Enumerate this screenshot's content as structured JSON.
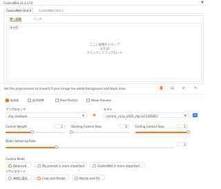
{
  "header": {
    "title": "ControlNet v1.1.174",
    "collapse_icon": "triangle-down-icon"
  },
  "tabs": [
    {
      "label": "ControlNet Unit 0",
      "active": true
    },
    {
      "label": "ControlNet Unit 1",
      "active": false
    }
  ],
  "image_panel": {
    "subtabs": [
      {
        "label": "単一画像",
        "active": true
      },
      {
        "label": "バッチ",
        "active": false
      }
    ],
    "image_label": "画像",
    "drop_text": [
      "ここに画像をドロップ",
      "-または-",
      "クリックしてアップロード"
    ]
  },
  "note": "Set the preprocessor to [invert] If your image has white background and black lines.",
  "toolbar_icons": [
    "camera-icon",
    "clipboard-icon",
    "swap-icon",
    "pencil-icon"
  ],
  "checkboxes": [
    {
      "label": "有効化",
      "checked": true
    },
    {
      "label": "低VRAM",
      "checked": false
    },
    {
      "label": "Pixel Perfect",
      "checked": false
    },
    {
      "label": "Allow Preview",
      "checked": false
    }
  ],
  "preprocessor": {
    "label": "プリプロセッサ",
    "value": "clip_example"
  },
  "model": {
    "label": "モデル",
    "value": "control_v11p_sd15_clip [a7236585]"
  },
  "sliders": {
    "weight": {
      "label": "Control Weight",
      "value": "1",
      "fraction": 0.45
    },
    "start": {
      "label": "Starting Control Step",
      "value": "0",
      "fraction": 0.0
    },
    "end": {
      "label": "Ending Control Step",
      "value": "1",
      "fraction": 1.0
    },
    "annotator": {
      "label": "Down Sampling Rate",
      "value": "2",
      "fraction": 0.3
    }
  },
  "control_mode": {
    "label": "Control Mode",
    "options": [
      {
        "label": "Balanced",
        "selected": true
      },
      {
        "label": "My prompt is more important",
        "selected": false
      },
      {
        "label": "ControlNet is more important",
        "selected": false
      }
    ]
  },
  "resize_mode": {
    "label": "リサイズモード",
    "options": [
      {
        "label": "単純に変形",
        "selected": false
      },
      {
        "label": "Crop and Resize",
        "selected": true
      },
      {
        "label": "Resize and Fill",
        "selected": false
      }
    ]
  },
  "colors": {
    "accent": "#f97316",
    "border": "#e5e7eb"
  }
}
